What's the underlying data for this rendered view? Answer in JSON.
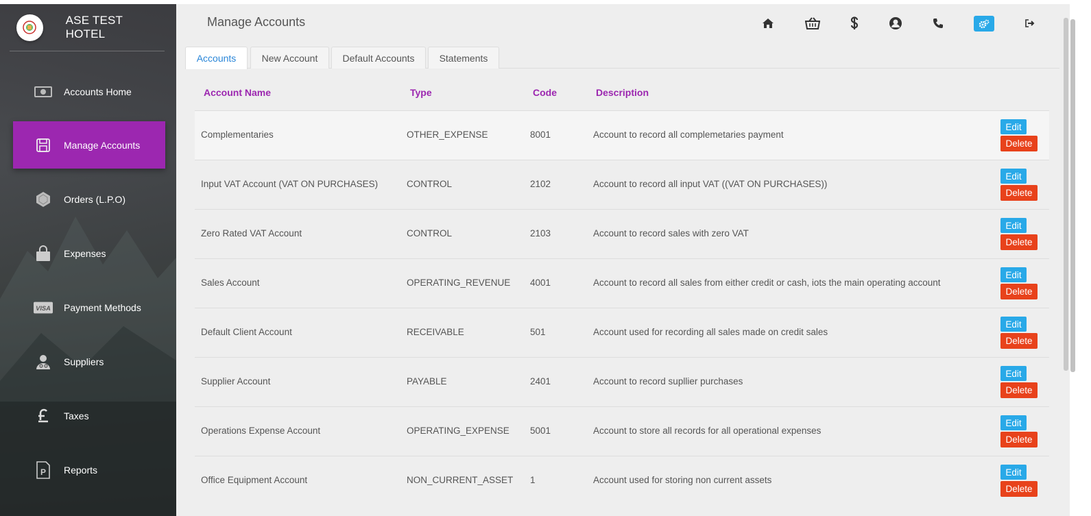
{
  "app": {
    "hotel_name": "ASE TEST HOTEL"
  },
  "sidebar": {
    "items": [
      {
        "label": "Accounts Home",
        "icon": "money-icon",
        "active": false
      },
      {
        "label": "Manage Accounts",
        "icon": "save-icon",
        "active": true
      },
      {
        "label": "Orders (L.P.O)",
        "icon": "orders-icon",
        "active": false
      },
      {
        "label": "Expenses",
        "icon": "shopping-bag-icon",
        "active": false
      },
      {
        "label": "Payment Methods",
        "icon": "visa-icon",
        "active": false
      },
      {
        "label": "Suppliers",
        "icon": "user-md-icon",
        "active": false
      },
      {
        "label": "Taxes",
        "icon": "pound-icon",
        "active": false
      },
      {
        "label": "Reports",
        "icon": "report-icon",
        "active": false
      }
    ]
  },
  "header": {
    "title": "Manage Accounts",
    "icons": [
      "home-icon",
      "basket-icon",
      "dollar-icon",
      "user-icon",
      "phone-icon",
      "cogs-icon",
      "sign-out-icon"
    ]
  },
  "tabs": [
    {
      "label": "Accounts",
      "active": true
    },
    {
      "label": "New Account",
      "active": false
    },
    {
      "label": "Default Accounts",
      "active": false
    },
    {
      "label": "Statements",
      "active": false
    }
  ],
  "table": {
    "headers": {
      "name": "Account Name",
      "type": "Type",
      "code": "Code",
      "description": "Description"
    },
    "edit_label": "Edit",
    "delete_label": "Delete",
    "rows": [
      {
        "name": "Complementaries",
        "type": "OTHER_EXPENSE",
        "code": "8001",
        "description": "Account to record all complemetaries payment"
      },
      {
        "name": "Input VAT Account (VAT ON PURCHASES)",
        "type": "CONTROL",
        "code": "2102",
        "description": "Account to record all input VAT ((VAT ON PURCHASES))"
      },
      {
        "name": "Zero Rated VAT Account",
        "type": "CONTROL",
        "code": "2103",
        "description": "Account to record sales with zero VAT"
      },
      {
        "name": "Sales Account",
        "type": "OPERATING_REVENUE",
        "code": "4001",
        "description": "Account to record all sales from either credit or cash, iots the main operating account"
      },
      {
        "name": "Default Client Account",
        "type": "RECEIVABLE",
        "code": "501",
        "description": "Account used for recording all sales made on credit sales"
      },
      {
        "name": "Supplier Account",
        "type": "PAYABLE",
        "code": "2401",
        "description": "Account to record supllier purchases"
      },
      {
        "name": "Operations Expense Account",
        "type": "OPERATING_EXPENSE",
        "code": "5001",
        "description": "Account to store all records for all operational expenses"
      },
      {
        "name": "Office Equipment Account",
        "type": "NON_CURRENT_ASSET",
        "code": "1",
        "description": "Account used for storing non current assets"
      }
    ]
  },
  "colors": {
    "accent": "#9c27b0",
    "edit": "#29a9e8",
    "delete": "#e8421b",
    "tab_active": "#2a86d8"
  }
}
